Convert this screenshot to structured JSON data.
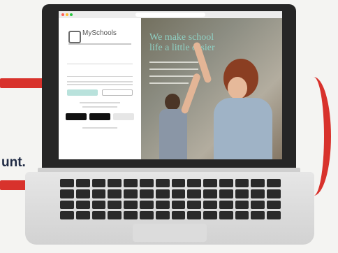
{
  "background_text": "unt.",
  "screen": {
    "brand": "MySchools",
    "headline_line1": "We make school",
    "headline_line2": "life a little easier"
  },
  "colors": {
    "accent_red": "#d8322c",
    "teal": "#8fd0c3",
    "navy": "#1f2a44"
  }
}
